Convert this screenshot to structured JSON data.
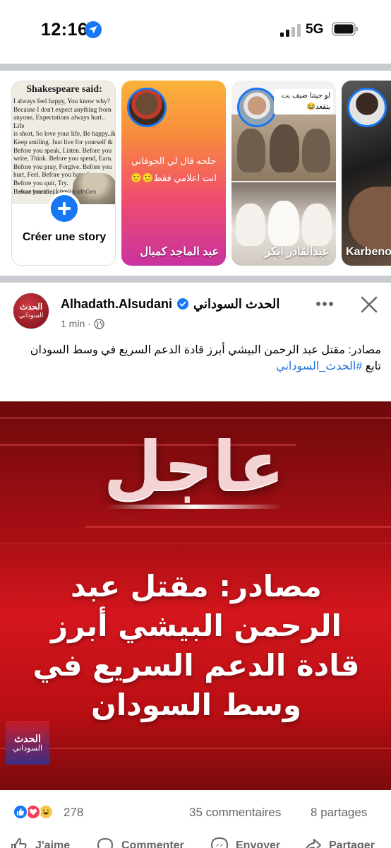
{
  "status_bar": {
    "time": "12:16",
    "network": "5G"
  },
  "stories": {
    "create": {
      "quote_title": "Shakespeare said:",
      "quote_text": "I always feel happy, You know why?\nBecause I don't expect anything from\nanyone, Expectations always hurt.. Life\nis short, So love your life, Be happy..&\nKeep smiling. Just live for yourself &\nBefore you speak, Listen. Before you\nwrite, Think. Before you spend, Earn.\nBefore you pray, Forgive. Before you\nhurt, Feel. Before you hate, Love.\nBefore you quit, Try.\nBefore you die, Live.",
      "quote_url": "www.facebook.com/HealthGen",
      "label": "Créer une story"
    },
    "items": [
      {
        "text": "جلحه قال لي الجوفاني انت اعلامي فقط🙂🙂",
        "name": "عبد الماجد كمبال"
      },
      {
        "text": "لو جيتنا ضيف بت بتقعد😂",
        "name": "عبدالقادر ابكر"
      },
      {
        "text": "",
        "name": "Karbeno"
      }
    ]
  },
  "post": {
    "page_name": "Alhadath.Alsudani الحدث السوداني",
    "page_name_latin": "Alhadath.Alsudani",
    "page_name_arabic": "الحدث السوداني",
    "avatar_line1": "الحدث",
    "avatar_line2": "السوداني",
    "time": "1 min ·",
    "text_line1": "مصادر: مقتل عبد الرحمن البيشي أبرز قادة الدعم السريع في وسط السودان",
    "follow_prefix": "تابع",
    "hashtag": "#الحدث_السوداني",
    "image": {
      "breaking": "عاجل",
      "headline": "مصادر: مقتل عبد الرحمن البيشي أبرز قادة الدعم السريع في وسط السودان",
      "logo_line1": "الحدث",
      "logo_line2": "السوداني"
    },
    "reactions_count": "278",
    "comments": "35 commentaires",
    "shares": "8 partages",
    "actions": {
      "like": "J'aime",
      "comment": "Commenter",
      "send": "Envoyer",
      "share": "Partager"
    }
  },
  "colors": {
    "brand_blue": "#1877f2",
    "hashtag": "#216fdb",
    "breaking_red": "#d5161d",
    "muted_text": "#65676b"
  },
  "icons": [
    "location-arrow-icon",
    "signal-icon",
    "battery-icon",
    "plus-icon",
    "verified-icon",
    "globe-icon",
    "more-icon",
    "close-icon",
    "like-reaction-icon",
    "love-reaction-icon",
    "haha-reaction-icon",
    "like-icon",
    "comment-icon",
    "send-icon",
    "share-icon"
  ]
}
